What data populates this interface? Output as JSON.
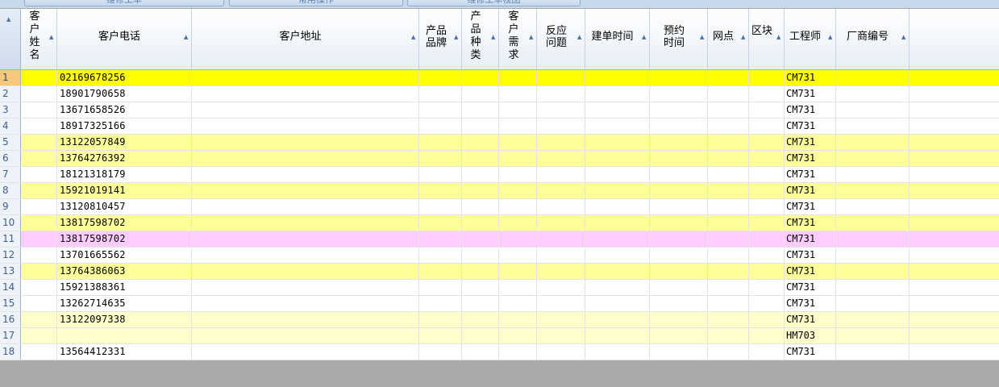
{
  "top_tabs": [
    "维修工单",
    "常用操作",
    "维修工单视图"
  ],
  "columns": [
    {
      "key": "name",
      "label": "客户姓名"
    },
    {
      "key": "phone",
      "label": "客户电话"
    },
    {
      "key": "address",
      "label": "客户地址"
    },
    {
      "key": "brand",
      "label": "产品品牌"
    },
    {
      "key": "category",
      "label": "产品种类"
    },
    {
      "key": "demand",
      "label": "客户需求"
    },
    {
      "key": "issue",
      "label": "反应问题"
    },
    {
      "key": "created",
      "label": "建单时间"
    },
    {
      "key": "appointment",
      "label": "预约时间"
    },
    {
      "key": "outlet",
      "label": "网点"
    },
    {
      "key": "block",
      "label": "区块"
    },
    {
      "key": "engineer",
      "label": "工程师"
    },
    {
      "key": "vendor_no",
      "label": "厂商编号"
    }
  ],
  "colors": {
    "selected": "#ffff00",
    "highlight": "#ffff99",
    "pink": "#ffccff",
    "pale": "#ffffcc",
    "white": "#ffffff"
  },
  "rows": [
    {
      "num": "1",
      "phone": "02169678256",
      "engineer": "CM731",
      "style": "selected"
    },
    {
      "num": "2",
      "phone": "18901790658",
      "engineer": "CM731",
      "style": "white"
    },
    {
      "num": "3",
      "phone": "13671658526",
      "engineer": "CM731",
      "style": "white"
    },
    {
      "num": "4",
      "phone": "18917325166",
      "engineer": "CM731",
      "style": "white"
    },
    {
      "num": "5",
      "phone": "13122057849",
      "engineer": "CM731",
      "style": "highlight"
    },
    {
      "num": "6",
      "phone": "13764276392",
      "engineer": "CM731",
      "style": "highlight"
    },
    {
      "num": "7",
      "phone": "18121318179",
      "engineer": "CM731",
      "style": "white"
    },
    {
      "num": "8",
      "phone": "15921019141",
      "engineer": "CM731",
      "style": "highlight"
    },
    {
      "num": "9",
      "phone": "13120810457",
      "engineer": "CM731",
      "style": "white"
    },
    {
      "num": "10",
      "phone": "13817598702",
      "engineer": "CM731",
      "style": "highlight"
    },
    {
      "num": "11",
      "phone": "13817598702",
      "engineer": "CM731",
      "style": "pink"
    },
    {
      "num": "12",
      "phone": "13701665562",
      "engineer": "CM731",
      "style": "white"
    },
    {
      "num": "13",
      "phone": "13764386063",
      "engineer": "CM731",
      "style": "highlight"
    },
    {
      "num": "14",
      "phone": "15921388361",
      "engineer": "CM731",
      "style": "white"
    },
    {
      "num": "15",
      "phone": "13262714635",
      "engineer": "CM731",
      "style": "white"
    },
    {
      "num": "16",
      "phone": "13122097338",
      "engineer": "CM731",
      "style": "pale"
    },
    {
      "num": "17",
      "phone": "",
      "engineer": "HM703",
      "style": "pale"
    },
    {
      "num": "18",
      "phone": "13564412331",
      "engineer": "CM731",
      "style": "white"
    }
  ]
}
